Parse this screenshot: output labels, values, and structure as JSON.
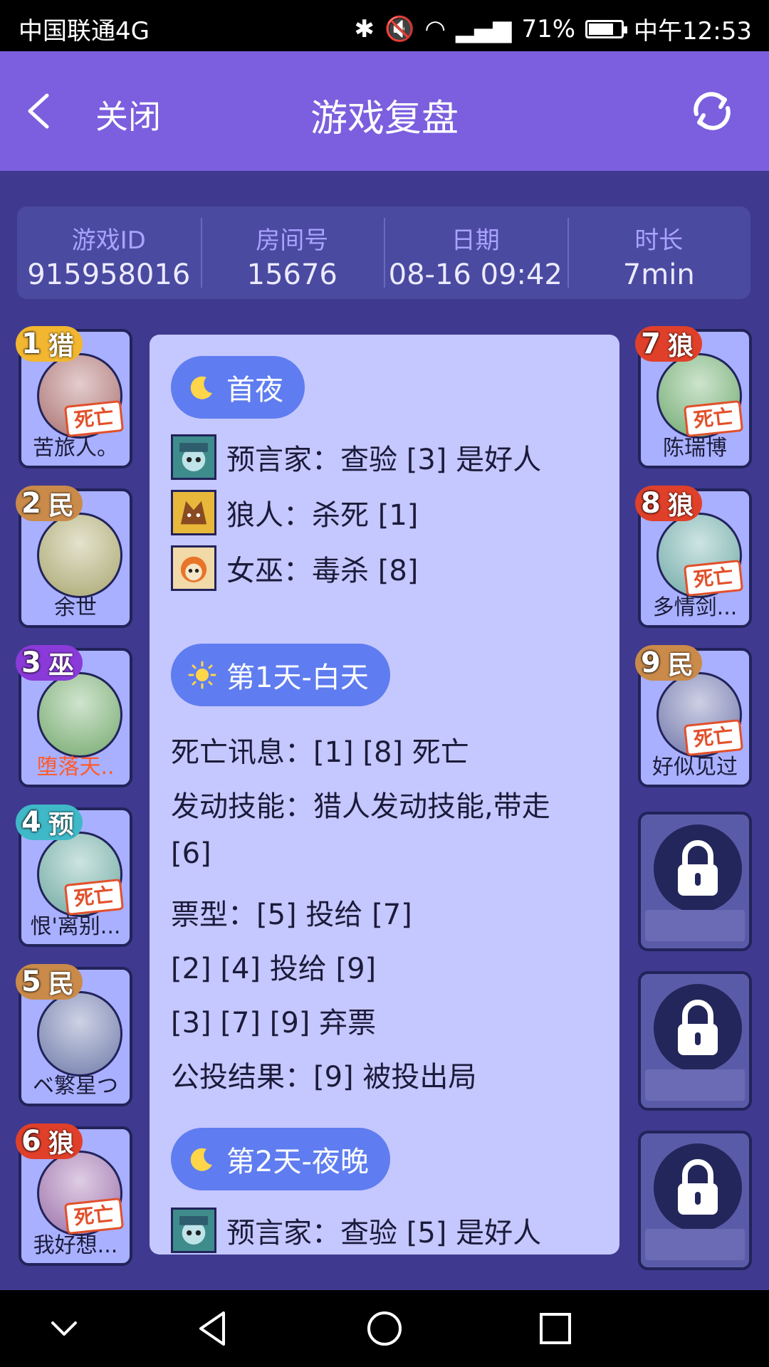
{
  "status_bar": {
    "carrier": "中国联通4G",
    "battery_percent": "71%",
    "battery_level": 0.71,
    "time": "中午12:53"
  },
  "header": {
    "close_label": "关闭",
    "title": "游戏复盘"
  },
  "info": {
    "game_id_label": "游戏ID",
    "game_id": "915958016",
    "room_label": "房间号",
    "room": "15676",
    "date_label": "日期",
    "date": "08-16 09:42",
    "duration_label": "时长",
    "duration": "7min"
  },
  "dead_label": "死亡",
  "players_left": [
    {
      "num": "1",
      "role": "猎",
      "name": "苦旅人。",
      "dead": true,
      "badge_color": "#f2b630"
    },
    {
      "num": "2",
      "role": "民",
      "name": "余世",
      "dead": false,
      "badge_color": "#c98a4a"
    },
    {
      "num": "3",
      "role": "巫",
      "name": "堕落天..",
      "dead": false,
      "badge_color": "#8a3ad8",
      "name_red": true
    },
    {
      "num": "4",
      "role": "预",
      "name": "恨'离别...",
      "dead": true,
      "badge_color": "#3fb8c8"
    },
    {
      "num": "5",
      "role": "民",
      "name": "ベ繁星つ",
      "dead": false,
      "badge_color": "#c98a4a"
    },
    {
      "num": "6",
      "role": "狼",
      "name": "我好想...",
      "dead": true,
      "badge_color": "#e0402a"
    }
  ],
  "players_right": [
    {
      "num": "7",
      "role": "狼",
      "name": "陈瑞博",
      "dead": true,
      "badge_color": "#e0402a"
    },
    {
      "num": "8",
      "role": "狼",
      "name": "多情剑...",
      "dead": true,
      "badge_color": "#e0402a"
    },
    {
      "num": "9",
      "role": "民",
      "name": "好似见过",
      "dead": true,
      "badge_color": "#c98a4a"
    }
  ],
  "log": {
    "night1": "首夜",
    "seer_check_1": "预言家：查验 [3] 是好人",
    "wolf_kill": "狼人：杀死 [1]",
    "witch_poison": "女巫：毒杀 [8]",
    "day1": "第1天-白天",
    "death_news": "死亡讯息：[1] [8] 死亡",
    "skill_1": "发动技能：猎人发动技能,带走",
    "skill_2": "[6]",
    "vote_1": "票型：[5] 投给 [7]",
    "vote_2": "[2] [4] 投给 [9]",
    "vote_3": "[3] [7] [9] 弃票",
    "vote_result": "公投结果：[9] 被投出局",
    "night2": "第2天-夜晚",
    "seer_check_2": "预言家：查验 [5] 是好人"
  },
  "colors": {
    "header": "#7b5fde",
    "background": "#3f3a8f",
    "panel": "#c5c7ff",
    "pill": "#5f7df0",
    "dead": "#e2502b"
  }
}
